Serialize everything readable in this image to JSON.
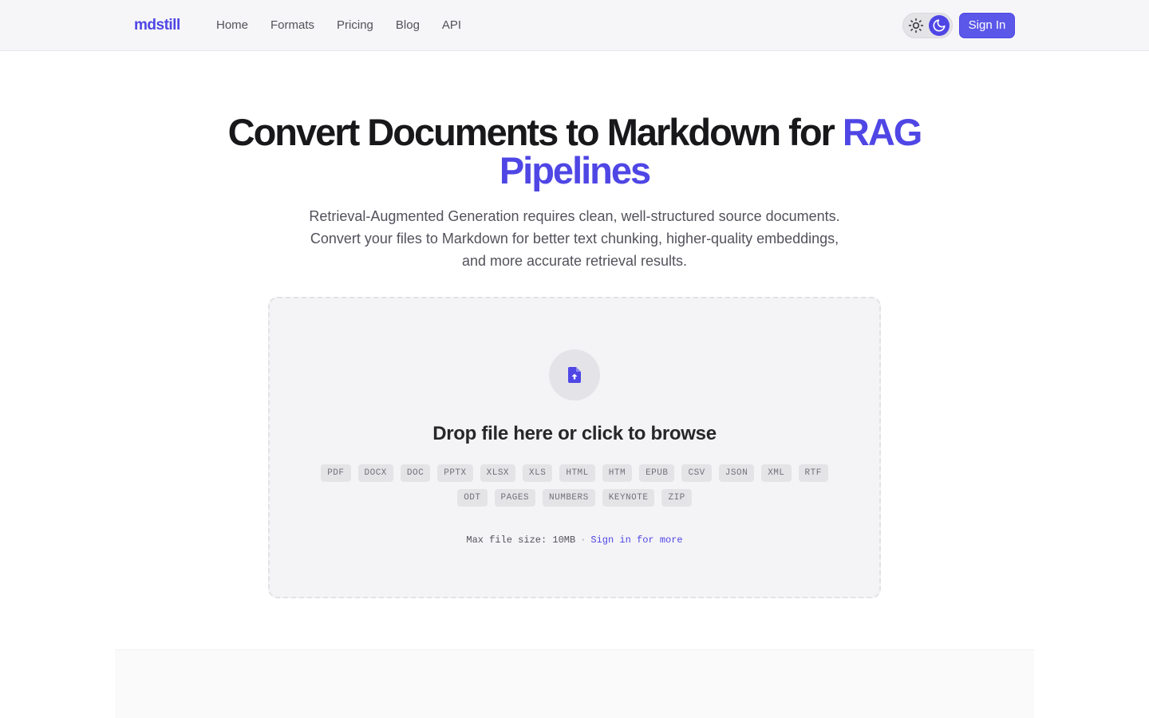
{
  "nav": {
    "logo": "mdstill",
    "links": [
      "Home",
      "Formats",
      "Pricing",
      "Blog",
      "API"
    ],
    "signin_label": "Sign In",
    "theme_toggle": {
      "options": [
        "sun-icon",
        "moon-icon"
      ],
      "active": "moon-icon"
    }
  },
  "hero": {
    "title_main": "Convert Documents to Markdown for ",
    "title_accent": "RAG Pipelines",
    "subtitle": "Retrieval-Augmented Generation requires clean, well-structured source documents. Convert your files to Markdown for better text chunking, higher-quality embeddings, and more accurate retrieval results."
  },
  "dropzone": {
    "icon": "file-upload-icon",
    "title": "Drop file here or click to browse",
    "formats": [
      "PDF",
      "DOCX",
      "DOC",
      "PPTX",
      "XLSX",
      "XLS",
      "HTML",
      "HTM",
      "EPUB",
      "CSV",
      "JSON",
      "XML",
      "RTF",
      "ODT",
      "PAGES",
      "NUMBERS",
      "KEYNOTE",
      "ZIP"
    ],
    "limit_text": "Max file size: 10MB",
    "separator": "·",
    "more_link": "Sign in for more"
  },
  "colors": {
    "accent": "#4f46e5",
    "nav_bg": "#f6f6f8",
    "dropzone_bg": "#f4f4f6"
  }
}
